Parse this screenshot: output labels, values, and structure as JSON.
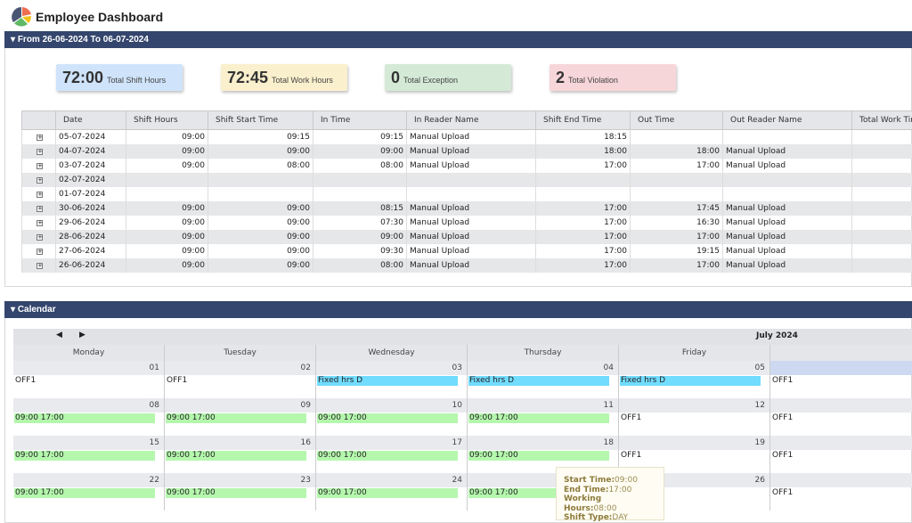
{
  "title": "Employee Dashboard",
  "range_panel": {
    "title": "From 26-06-2024 To 06-07-2024"
  },
  "cards": [
    {
      "value": "72:00",
      "label": "Total Shift Hours",
      "color": "#cfe4fb"
    },
    {
      "value": "72:45",
      "label": "Total Work Hours",
      "color": "#fbf0cd"
    },
    {
      "value": "0",
      "label": "Total Exception",
      "color": "#d4ead6"
    },
    {
      "value": "2",
      "label": "Total Violation",
      "color": "#f7d6d9"
    }
  ],
  "table": {
    "columns": [
      "Date",
      "Shift Hours",
      "Shift Start Time",
      "In Time",
      "In Reader Name",
      "Shift End Time",
      "Out Time",
      "Out Reader Name",
      "Total Work Time"
    ],
    "rows": [
      [
        "05-07-2024",
        "09:00",
        "09:15",
        "09:15",
        "Manual Upload",
        "18:15",
        "",
        "",
        ""
      ],
      [
        "04-07-2024",
        "09:00",
        "09:00",
        "09:00",
        "Manual Upload",
        "18:00",
        "18:00",
        "Manual Upload",
        ""
      ],
      [
        "03-07-2024",
        "09:00",
        "08:00",
        "08:00",
        "Manual Upload",
        "17:00",
        "17:00",
        "Manual Upload",
        ""
      ],
      [
        "02-07-2024",
        "",
        "",
        "",
        "",
        "",
        "",
        "",
        ""
      ],
      [
        "01-07-2024",
        "",
        "",
        "",
        "",
        "",
        "",
        "",
        ""
      ],
      [
        "30-06-2024",
        "09:00",
        "09:00",
        "08:15",
        "Manual Upload",
        "17:00",
        "17:45",
        "Manual Upload",
        ""
      ],
      [
        "29-06-2024",
        "09:00",
        "09:00",
        "07:30",
        "Manual Upload",
        "17:00",
        "16:30",
        "Manual Upload",
        ""
      ],
      [
        "28-06-2024",
        "09:00",
        "09:00",
        "09:00",
        "Manual Upload",
        "17:00",
        "17:00",
        "Manual Upload",
        ""
      ],
      [
        "27-06-2024",
        "09:00",
        "09:00",
        "09:30",
        "Manual Upload",
        "17:00",
        "19:15",
        "Manual Upload",
        ""
      ],
      [
        "26-06-2024",
        "09:00",
        "09:00",
        "08:00",
        "Manual Upload",
        "17:00",
        "17:00",
        "Manual Upload",
        ""
      ]
    ]
  },
  "calendar": {
    "title": "Calendar",
    "month": "July 2024",
    "prev": "◀",
    "next": "▶",
    "days": [
      "Monday",
      "Tuesday",
      "Wednesday",
      "Thursday",
      "Friday",
      ""
    ],
    "weeks": [
      [
        {
          "d": "01",
          "e": "OFF1",
          "t": ""
        },
        {
          "d": "02",
          "e": "OFF1",
          "t": ""
        },
        {
          "d": "03",
          "e": "Fixed  hrs  D",
          "t": "blue"
        },
        {
          "d": "04",
          "e": "Fixed  hrs  D",
          "t": "blue"
        },
        {
          "d": "05",
          "e": "Fixed  hrs  D",
          "t": "blue"
        },
        {
          "d": "",
          "e": "OFF1",
          "t": "",
          "sel": true
        }
      ],
      [
        {
          "d": "08",
          "e": "09:00  17:00",
          "t": "green"
        },
        {
          "d": "09",
          "e": "09:00  17:00",
          "t": "green"
        },
        {
          "d": "10",
          "e": "09:00  17:00",
          "t": "green"
        },
        {
          "d": "11",
          "e": "09:00  17:00",
          "t": "green"
        },
        {
          "d": "12",
          "e": "OFF1",
          "t": ""
        },
        {
          "d": "",
          "e": "OFF1",
          "t": ""
        }
      ],
      [
        {
          "d": "15",
          "e": "09:00  17:00",
          "t": "green"
        },
        {
          "d": "16",
          "e": "09:00  17:00",
          "t": "green"
        },
        {
          "d": "17",
          "e": "09:00  17:00",
          "t": "green"
        },
        {
          "d": "18",
          "e": "09:00  17:00",
          "t": "green"
        },
        {
          "d": "19",
          "e": "OFF1",
          "t": ""
        },
        {
          "d": "",
          "e": "OFF1",
          "t": ""
        }
      ],
      [
        {
          "d": "22",
          "e": "09:00  17:00",
          "t": "green"
        },
        {
          "d": "23",
          "e": "09:00  17:00",
          "t": "green"
        },
        {
          "d": "24",
          "e": "09:00  17:00",
          "t": "green"
        },
        {
          "d": "25",
          "e": "09:00  17:00",
          "t": "green"
        },
        {
          "d": "26",
          "e": "OFF1",
          "t": ""
        },
        {
          "d": "",
          "e": "OFF1",
          "t": ""
        }
      ]
    ]
  },
  "tooltip": [
    {
      "k": "Start Time:",
      "v": "09:00"
    },
    {
      "k": "End Time:",
      "v": "17:00"
    },
    {
      "k": "Working Hours:",
      "v": "08:00"
    },
    {
      "k": "Shift Type:",
      "v": "DAY"
    }
  ]
}
